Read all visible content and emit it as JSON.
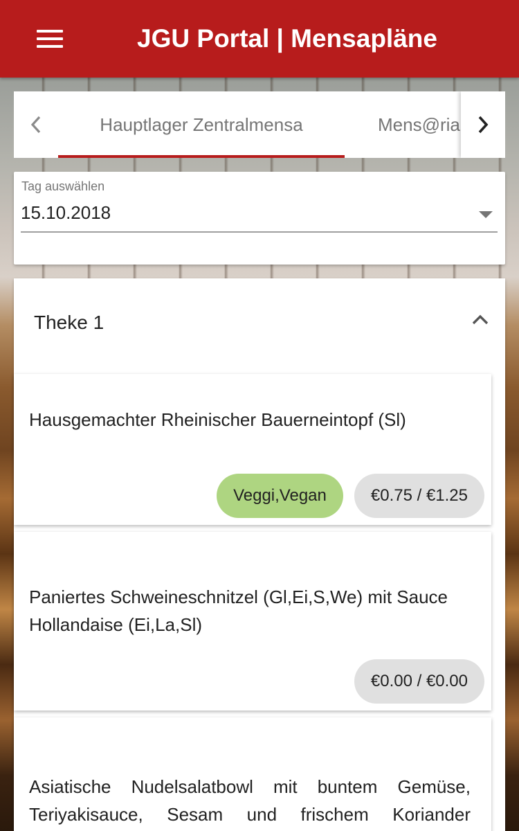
{
  "appbar": {
    "title": "JGU Portal | Mensapläne",
    "menu_icon": "hamburger-menu-icon"
  },
  "tabs": {
    "prev_icon": "chevron-left-icon",
    "next_icon": "chevron-right-icon",
    "items": [
      {
        "label": "Hauptlager Zentralmensa",
        "selected": true
      },
      {
        "label": "Mens@ria"
      }
    ]
  },
  "day_select": {
    "label": "Tag auswählen",
    "value": "15.10.2018",
    "icon": "dropdown-arrow-icon"
  },
  "theke": {
    "title": "Theke 1",
    "icon": "chevron-up-icon",
    "meals": [
      {
        "name": "Hausgemachter Rheinischer Bauerneintopf (Sl)",
        "tag": "Veggi,Vegan",
        "price": "€0.75 / €1.25"
      },
      {
        "name": "Paniertes Schweineschnitzel (Gl,Ei,S,We) mit Sauce Hollandaise (Ei,La,Sl)",
        "price": "€0.00 / €0.00"
      },
      {
        "name": "Asiatische Nudelsalatbowl mit buntem Gemüse, Teriyakisauce, Sesam und frischem Koriander (Gl,So,Se,We)"
      }
    ]
  },
  "colors": {
    "primary": "#b71c1c",
    "veg_chip": "#aed581",
    "price_chip": "#e0e0e0"
  }
}
